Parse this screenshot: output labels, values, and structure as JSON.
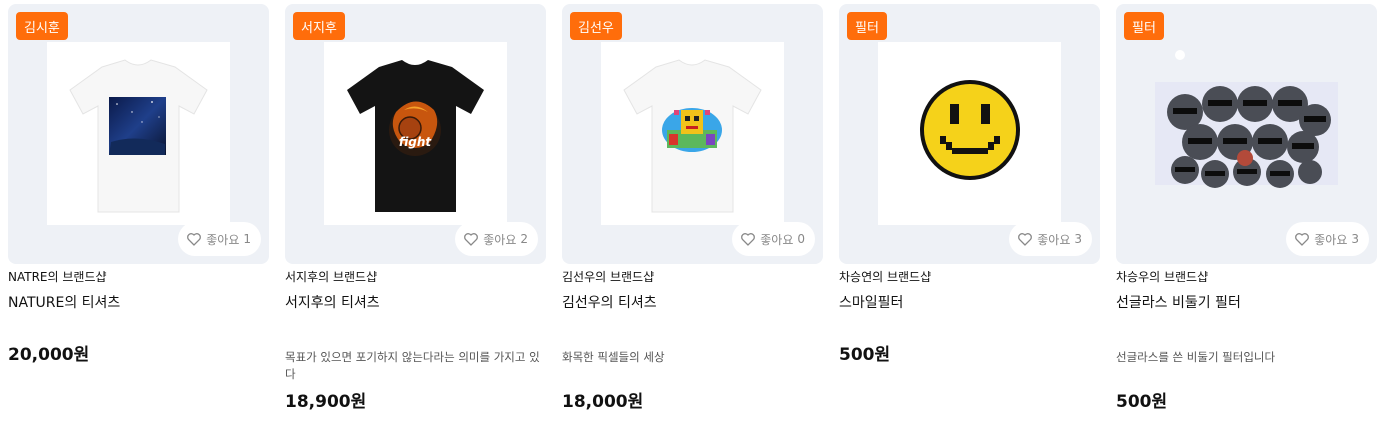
{
  "like_label": "좋아요",
  "products": [
    {
      "badge": "김시훈",
      "shop": "NATRE의 브랜드샵",
      "title": "NATURE의 티셔츠",
      "desc": "",
      "price": "20,000원",
      "likes": "1",
      "image": "white-tshirt-night-sky-print"
    },
    {
      "badge": "서지후",
      "shop": "서지후의 브랜드샵",
      "title": "서지후의 티셔츠",
      "desc": "목표가 있으면 포기하지 않는다라는 의미를 가지고 있다",
      "price": "18,900원",
      "likes": "2",
      "image": "black-tshirt-fight-basketball"
    },
    {
      "badge": "김선우",
      "shop": "김선우의 브랜드샵",
      "title": "김선우의 티셔츠",
      "desc": "화목한 픽셀들의 세상",
      "price": "18,000원",
      "likes": "0",
      "image": "white-tshirt-pixel-characters"
    },
    {
      "badge": "필터",
      "shop": "차승연의 브랜드샵",
      "title": "스마일필터",
      "desc": "",
      "price": "500원",
      "likes": "3",
      "image": "pixel-smiley-face"
    },
    {
      "badge": "필터",
      "shop": "차승우의 브랜드샵",
      "title": "선글라스 비둘기 필터",
      "desc": "선글라스를 쓴 비둘기 필터입니다",
      "price": "500원",
      "likes": "3",
      "image": "pigeons-with-sunglasses"
    }
  ]
}
